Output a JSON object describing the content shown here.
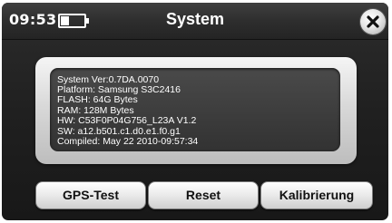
{
  "status_bar": {
    "time": "09:53",
    "battery_level": 0.35
  },
  "header": {
    "title": "System"
  },
  "info": {
    "lines": [
      "System Ver:0.7DA.0070",
      "Platform: Samsung S3C2416",
      "FLASH: 64G Bytes",
      "RAM: 128M Bytes",
      "HW: C53F0P04G756_L23A V1.2",
      "SW: a12.b501.c1.d0.e1.f0.g1",
      "Compiled: May 22 2010-09:57:34"
    ]
  },
  "buttons": {
    "gps_test": "GPS-Test",
    "reset": "Reset",
    "calibration": "Kalibrierung"
  },
  "icons": {
    "close": "close-icon",
    "battery": "battery-icon"
  },
  "colors": {
    "background": "#1f1f1f",
    "text": "#ffffff",
    "button_text": "#111111"
  }
}
